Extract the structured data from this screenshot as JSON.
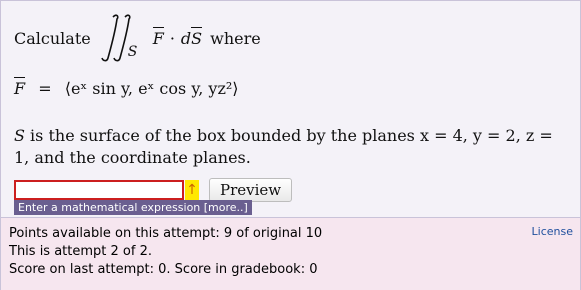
{
  "question": {
    "calculate_word": "Calculate",
    "integral_subscript": "S",
    "integrand_F": "F",
    "dot": "·",
    "d": "d",
    "S_vec": "S",
    "where_word": "where",
    "field_lhs": "F",
    "field_equals": "=",
    "field_rhs": "⟨eˣ sin y, eˣ cos y, yz²⟩",
    "surface_S": "S",
    "surface_text": " is the surface of the box bounded by the planes x = 4, y = 2, z = 1, and the coordinate planes."
  },
  "answer": {
    "value": "",
    "placeholder": "",
    "warning_icon": "arrow-up-icon",
    "warning_glyph": "↑",
    "preview_label": "Preview",
    "hint_text": "Enter a mathematical expression [more..]"
  },
  "status": {
    "points_line": "Points available on this attempt: 9 of original 10",
    "attempt_line": "This is attempt 2 of 2.",
    "score_line": "Score on last attempt: 0. Score in gradebook: 0",
    "license_label": "License"
  },
  "colors": {
    "input_border": "#cc1f1f",
    "warning_bg": "#ffe800",
    "hint_bg": "#6a5f90",
    "status_bg": "#f6e6ef",
    "link": "#1f4f9d"
  }
}
